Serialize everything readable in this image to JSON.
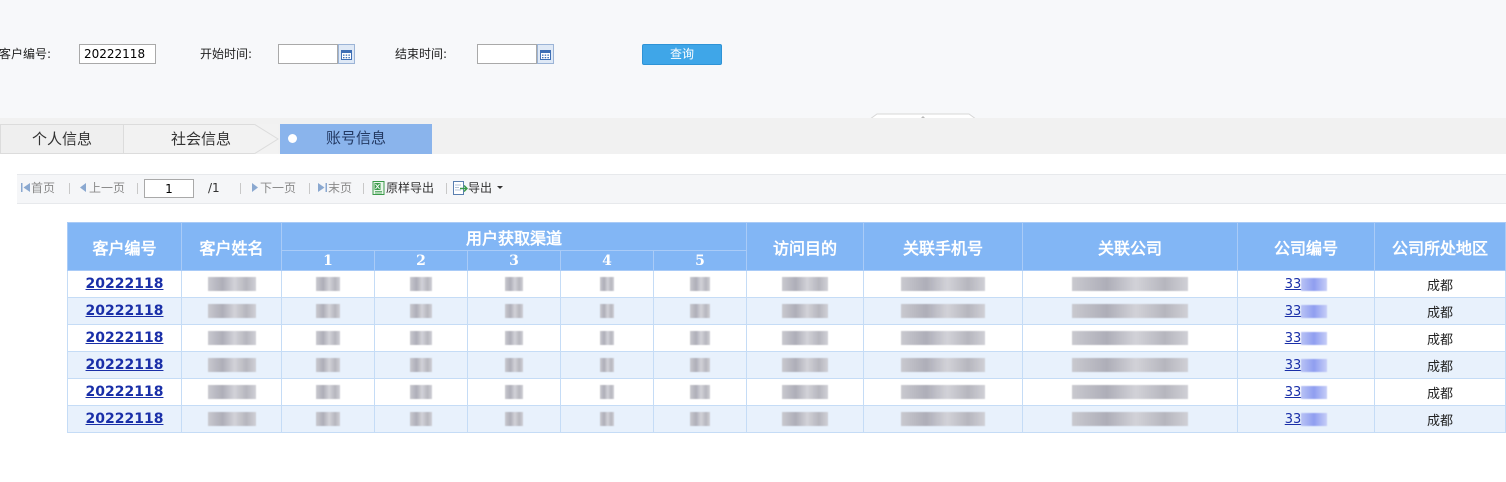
{
  "query": {
    "customer_no_label": "客户编号:",
    "customer_no_value": "20222118",
    "start_label": "开始时间:",
    "start_value": "",
    "end_label": "结束时间:",
    "end_value": "",
    "search_label": "查询"
  },
  "tabs": [
    {
      "label": "个人信息",
      "active": false
    },
    {
      "label": "社会信息",
      "active": false
    },
    {
      "label": "账号信息",
      "active": true
    }
  ],
  "toolbar": {
    "first": "首页",
    "prev": "上一页",
    "page_value": "1",
    "total": "/1",
    "next": "下一页",
    "last": "末页",
    "export_original": "原样导出",
    "export": "导出"
  },
  "table": {
    "headers": {
      "customer_no": "客户编号",
      "customer_name": "客户姓名",
      "channel": "用户获取渠道",
      "channel_subs": [
        "1",
        "2",
        "3",
        "4",
        "5"
      ],
      "visit_purpose": "访问目的",
      "phone": "关联手机号",
      "company": "关联公司",
      "company_no": "公司编号",
      "region": "公司所处地区"
    },
    "rows": [
      {
        "customer_no": "20222118",
        "company_no_prefix": "33",
        "region": "成都"
      },
      {
        "customer_no": "20222118",
        "company_no_prefix": "33",
        "region": "成都"
      },
      {
        "customer_no": "20222118",
        "company_no_prefix": "33",
        "region": "成都"
      },
      {
        "customer_no": "20222118",
        "company_no_prefix": "33",
        "region": "成都"
      },
      {
        "customer_no": "20222118",
        "company_no_prefix": "33",
        "region": "成都"
      },
      {
        "customer_no": "20222118",
        "company_no_prefix": "33",
        "region": "成都"
      }
    ]
  },
  "colors": {
    "header_bg": "#82b6f5",
    "active_tab": "#8ab4ec",
    "query_button": "#3fa6e8",
    "link": "#1a2fa8"
  }
}
